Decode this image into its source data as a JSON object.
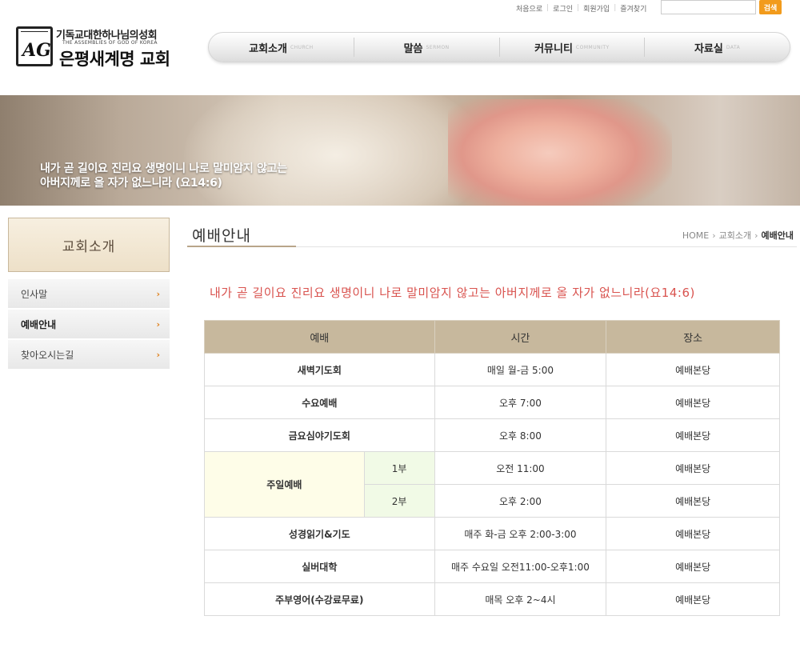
{
  "util": {
    "links": [
      "처음으로",
      "로그인",
      "회원가입",
      "즐겨찾기"
    ],
    "search_button": "검색",
    "search_value": ""
  },
  "logo": {
    "org": "기독교대한하나님의성회",
    "eng": "THE ASSEMBLIES OF GOD OF KOREA",
    "church": "은평새계명 교회",
    "mark": "AG"
  },
  "gnb": [
    {
      "ko": "교회소개",
      "en": "CHURCH"
    },
    {
      "ko": "말씀",
      "en": "SERMON"
    },
    {
      "ko": "커뮤니티",
      "en": "COMMUNITY"
    },
    {
      "ko": "자료실",
      "en": "DATA"
    }
  ],
  "banner": {
    "line1": "내가 곧 길이요 진리요 생명이니 나로 말미암지 않고는",
    "line2": "아버지께로 올 자가 없느니라 (요14:6)"
  },
  "sidebar": {
    "title": "교회소개",
    "items": [
      {
        "label": "인사말",
        "active": false
      },
      {
        "label": "예배안내",
        "active": true
      },
      {
        "label": "찾아오시는길",
        "active": false
      }
    ]
  },
  "content": {
    "title": "예배안내",
    "breadcrumb": [
      "HOME",
      "교회소개",
      "예배안내"
    ],
    "headline": "내가 곧 길이요 진리요 생명이니 나로 말미암지 않고는 아버지께로 올 자가 없느니라(요14:6)"
  },
  "table": {
    "headers": [
      "예배",
      "시간",
      "장소"
    ],
    "rows": [
      {
        "name": "새벽기도회",
        "time": "매일 월-금 5:00",
        "place": "예배본당"
      },
      {
        "name": "수요예배",
        "time": "오후 7:00",
        "place": "예배본당"
      },
      {
        "name": "금요심야기도회",
        "time": "오후 8:00",
        "place": "예배본당"
      },
      {
        "name": "성경읽기&기도",
        "time": "매주 화-금 오후 2:00-3:00",
        "place": "예배본당"
      },
      {
        "name": "실버대학",
        "time": "매주 수요일 오전11:00-오후1:00",
        "place": "예배본당"
      },
      {
        "name": "주부영어(수강료무료)",
        "time": "매목 오후 2~4시",
        "place": "예배본당"
      }
    ],
    "sunday": {
      "name": "주일예배",
      "parts": [
        {
          "part": "1부",
          "time": "오전 11:00",
          "place": "예배본당"
        },
        {
          "part": "2부",
          "time": "오후 2:00",
          "place": "예배본당"
        }
      ]
    }
  },
  "colors": {
    "accent": "#f29b1c",
    "headline": "#d9534f",
    "table_header": "#c7b89d",
    "sunday_bg": "#fefde8",
    "part_bg": "#f1fae6"
  }
}
